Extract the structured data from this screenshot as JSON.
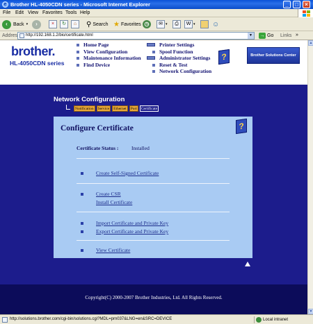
{
  "window": {
    "title": "Brother HL-4050CDN series - Microsoft Internet Explorer",
    "minimize": "_",
    "maximize": "□",
    "close": "×"
  },
  "menu": [
    "File",
    "Edit",
    "View",
    "Favorites",
    "Tools",
    "Help"
  ],
  "toolbar": {
    "back": "Back",
    "search": "Search",
    "favorites": "Favorites"
  },
  "address": {
    "label": "Address",
    "url": "http://192.168.1.2/bio/certificate.html",
    "go": "Go",
    "links": "Links"
  },
  "header": {
    "logo": "brother.",
    "model": "HL-4050CDN series",
    "nav_left": [
      "Home Page",
      "View Configuration",
      "Maintenance Information",
      "Find Device"
    ],
    "nav_right": [
      "Printer Settings",
      "Spool Function",
      "Administrator Settings",
      "Reset & Test",
      "Network Configuration"
    ],
    "solutions": "Brother Solutions Center"
  },
  "section": {
    "title": "Network Configuration",
    "tabs": [
      "Notification",
      "Service",
      "Ethernet",
      "Port",
      "Certificate"
    ],
    "active_tab": "Certificate"
  },
  "panel": {
    "title": "Configure Certificate",
    "status_label": "Certificate Status :",
    "status_value": "Installed",
    "links": [
      "Create Self-Signed Certificate",
      "Create CSR",
      "Install Certificate",
      "Import Certificate and Private Key",
      "Export Certificate and Private Key",
      "View Certificate"
    ]
  },
  "footer": {
    "copyright": "Copyright(C) 2000-2007 Brother Industries, Ltd. All Rights Reserved."
  },
  "status": {
    "text": "http://solutions.brother.com/cgi-bin/solutions.cgi?MDL=prn037&LNG=en&SRC=DEVICE",
    "zone": "Local intranet"
  },
  "colors": {
    "page_bg": "#1c1c8c",
    "panel_bg": "#a9cbf3",
    "footer_bg": "#0c0c5a",
    "tab_bg": "#e9a93a"
  }
}
